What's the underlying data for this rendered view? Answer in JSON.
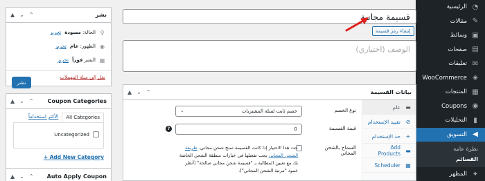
{
  "admin_menu": {
    "items": [
      {
        "icon": "dashboard-icon",
        "glyph": "◔",
        "label": "الرئيسية"
      },
      {
        "icon": "pin-icon",
        "glyph": "✎",
        "label": "مقالات"
      },
      {
        "icon": "media-icon",
        "glyph": "▣",
        "label": "وسائط"
      },
      {
        "icon": "pages-icon",
        "glyph": "▤",
        "label": "صفحات"
      },
      {
        "icon": "comments-icon",
        "glyph": "✉",
        "label": "تعليقات"
      },
      {
        "icon": "woo-icon",
        "glyph": "◈",
        "label": "WooCommerce"
      },
      {
        "icon": "products-icon",
        "glyph": "▦",
        "label": "المنتجات"
      },
      {
        "icon": "coupons-icon",
        "glyph": "◉",
        "label": "Coupons"
      },
      {
        "icon": "analytics-icon",
        "glyph": "▮",
        "label": "التحليلات"
      },
      {
        "icon": "marketing-icon",
        "glyph": "◀",
        "label": "التسويق"
      }
    ],
    "submenu": [
      "نظرة عامة",
      "القسائم"
    ],
    "after": {
      "icon": "appearance-icon",
      "glyph": "✦",
      "label": "المظهر"
    }
  },
  "title": {
    "value": "قسيمة مجانية"
  },
  "generate_code_button": "إنشاء رمز قسيمة",
  "description": {
    "placeholder": "الوصف (اختياري)"
  },
  "coupon_data": {
    "title": "بيانات القسيمة",
    "tabs": [
      {
        "icon": "general-icon",
        "glyph": "▬",
        "label": "عام"
      },
      {
        "icon": "restriction-icon",
        "glyph": "⊘",
        "label": "تقييد الإستخدام"
      },
      {
        "icon": "limits-icon",
        "glyph": "+",
        "label": "حد الإستخدام"
      },
      {
        "icon": "add-products-icon",
        "glyph": "▬",
        "label": "Add Products"
      },
      {
        "icon": "scheduler-icon",
        "glyph": "▦",
        "label": "Scheduler"
      }
    ],
    "discount_type_label": "نوع الخصم",
    "discount_type_value": "خصم ثابت لسلة المشتريات",
    "amount_label": "قيمة القسيمة",
    "amount_value": "0",
    "free_shipping_label": "السماح بالشحن المجاني",
    "free_shipping_desc_1": "حدد هذا الاختيار إذا كانت القسيمة تمنح شحن مجاني.",
    "free_shipping_link": "طريقة الشحن المجاني",
    "free_shipping_desc_2": "يجب تفعيلها في خيارات منطقة الشحن الخاصة بك مع تعيين المطالبة بـ \"قسيمة شحن مجاني صالحة\" (أنظر عمود \"مرتبة الشحن المجاني\")."
  },
  "publish": {
    "title": "نشر",
    "status_label": "الحالة:",
    "status_value": "مسودة",
    "visibility_label": "الظهور:",
    "visibility_value": "عام",
    "publish_label": "النشر",
    "publish_value": "فوراً",
    "edit_link": "تحرير",
    "trash_link": "نقل إلى سلة المهملات",
    "publish_button": "نشر"
  },
  "categories": {
    "title": "Coupon Categories",
    "tab_all": "All Categories",
    "tab_popular": "الأكثر استخداماً",
    "item": "Uncategorized",
    "add_new": "+ Add New Category"
  },
  "auto_apply": {
    "title": "Auto Apply Coupon"
  },
  "colors": {
    "accent": "#2271b1",
    "sidebar": "#1d2327",
    "annotation_arrow": "#e0201b"
  }
}
